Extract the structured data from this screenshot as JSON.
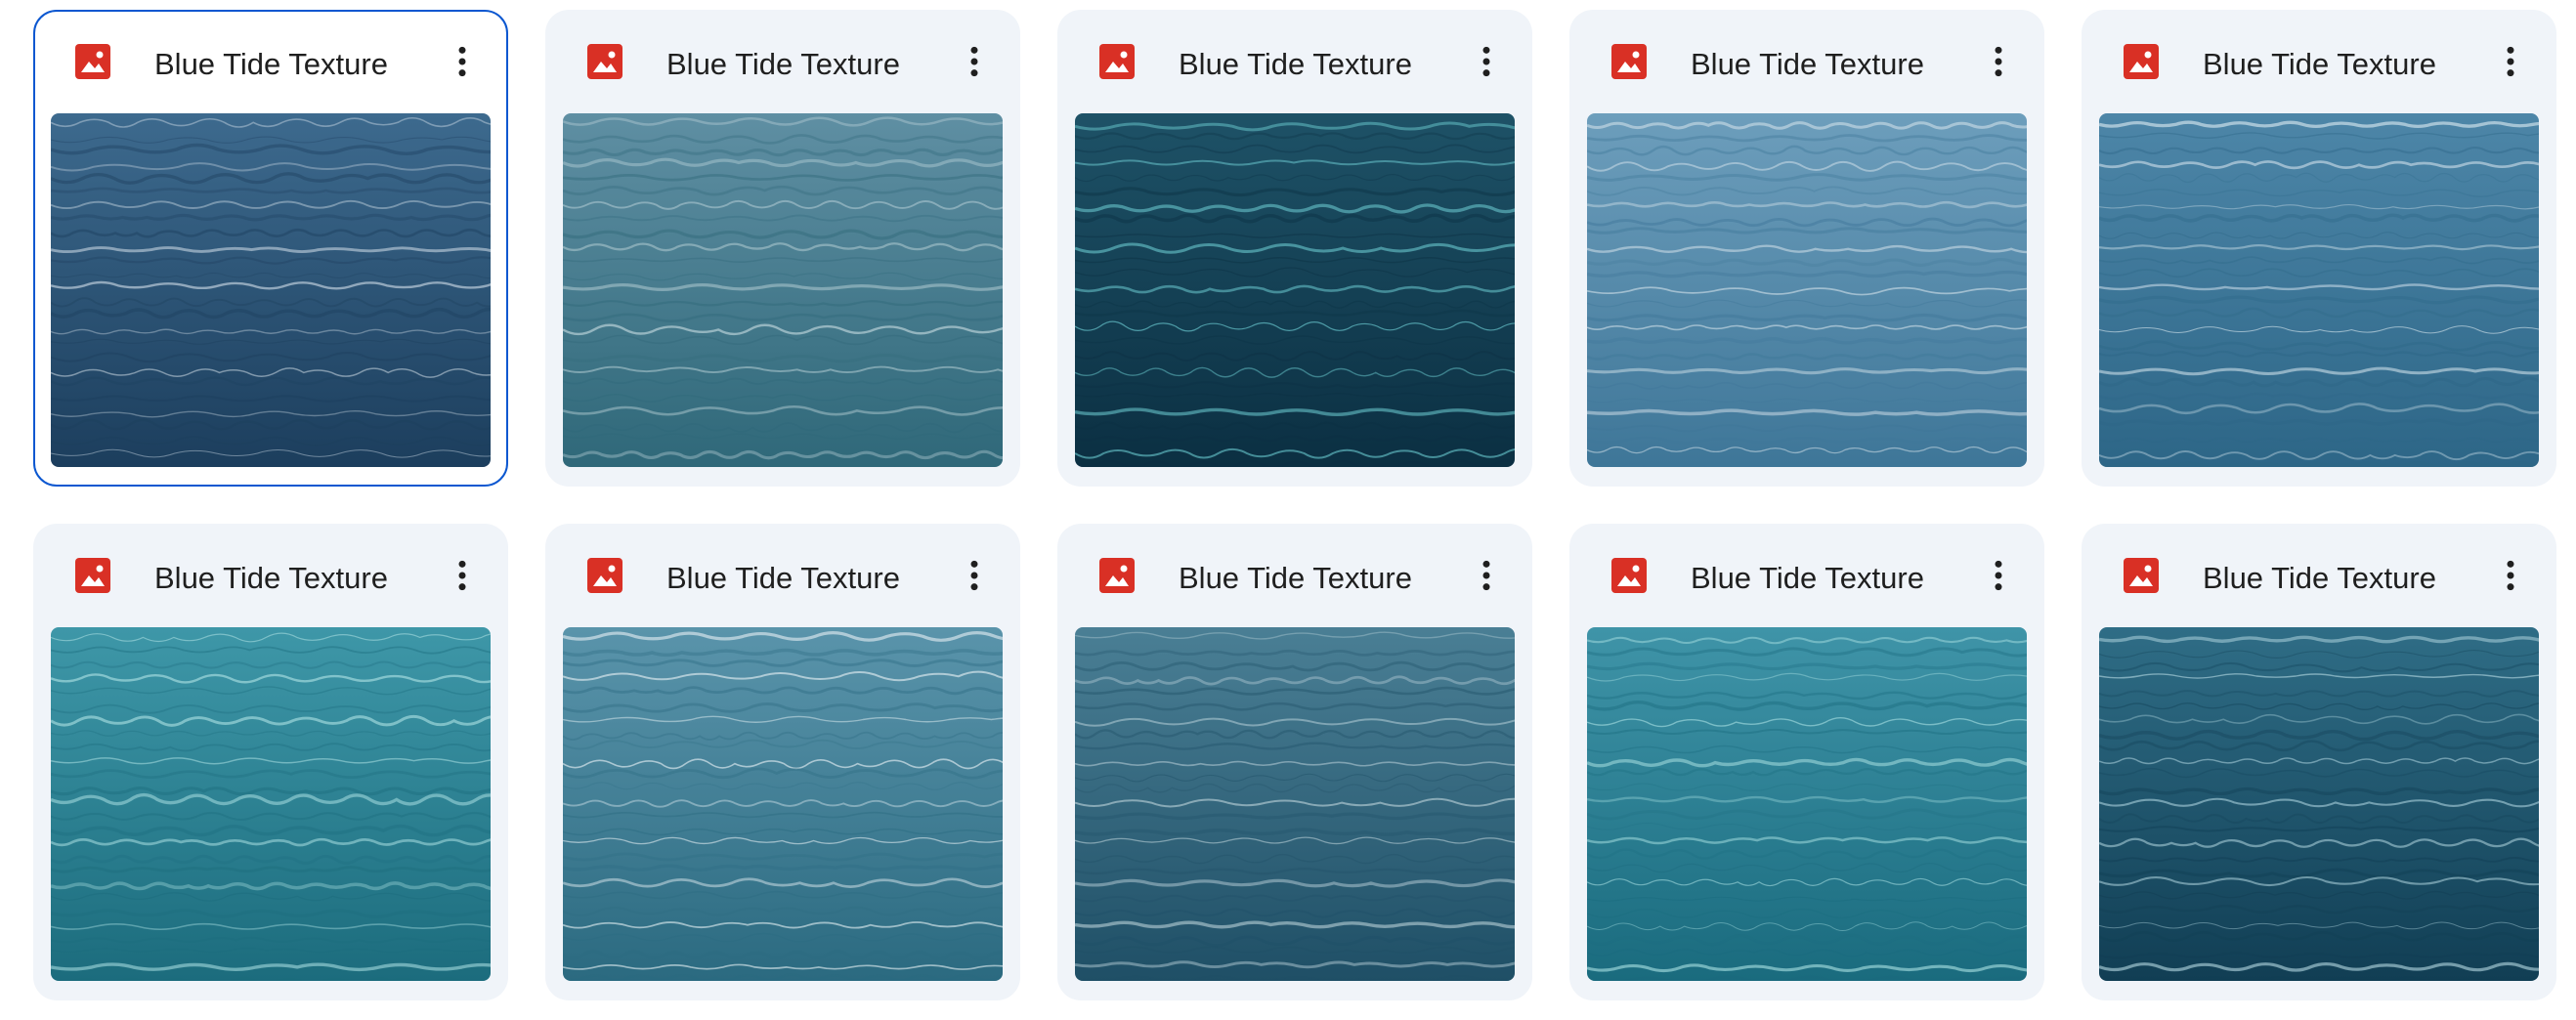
{
  "file_type_icon": "image-file-icon",
  "more_icon": "more-vert-icon",
  "colors": {
    "selected_border": "#0b57d0",
    "image_icon": "#d93025",
    "card_bg": "#f0f4f9"
  },
  "files": [
    {
      "name": "Blue Tide Texture",
      "selected": true,
      "palette": [
        "#3d6a8e",
        "#1c3e5d",
        "#cfdce6"
      ]
    },
    {
      "name": "Blue Tide Texture",
      "selected": false,
      "palette": [
        "#5f8fa3",
        "#2f6879",
        "#c7dbe0"
      ]
    },
    {
      "name": "Blue Tide Texture",
      "selected": false,
      "palette": [
        "#1e5267",
        "#0b2f42",
        "#6fd0d6"
      ]
    },
    {
      "name": "Blue Tide Texture",
      "selected": false,
      "palette": [
        "#6d9ebc",
        "#3e7698",
        "#dfeaf0"
      ]
    },
    {
      "name": "Blue Tide Texture",
      "selected": false,
      "palette": [
        "#4d86a8",
        "#2d6687",
        "#d8e7ef"
      ]
    },
    {
      "name": "Blue Tide Texture",
      "selected": false,
      "palette": [
        "#3e97a8",
        "#1c6c7d",
        "#aee2e4"
      ]
    },
    {
      "name": "Blue Tide Texture",
      "selected": false,
      "palette": [
        "#5a94ab",
        "#2b6a80",
        "#e3eef2"
      ]
    },
    {
      "name": "Blue Tide Texture",
      "selected": false,
      "palette": [
        "#4a7f95",
        "#1f4f66",
        "#c9dde3"
      ]
    },
    {
      "name": "Blue Tide Texture",
      "selected": false,
      "palette": [
        "#3f94a8",
        "#1a6b7e",
        "#a5dde0"
      ]
    },
    {
      "name": "Blue Tide Texture",
      "selected": false,
      "palette": [
        "#2f6d86",
        "#113e54",
        "#b4d8e2"
      ]
    }
  ]
}
